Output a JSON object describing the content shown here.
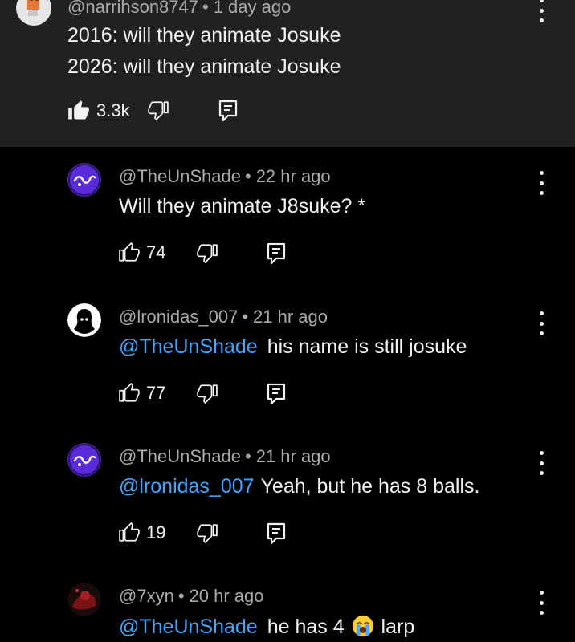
{
  "colors": {
    "background": "#000000",
    "highlight_bg": "#212121",
    "text": "#f1f1f1",
    "meta": "#aaaaaa",
    "mention": "#3ea6ff"
  },
  "comments": [
    {
      "author": "@narrihson8747",
      "time": "1 day ago",
      "lines": [
        "2016: will they animate Josuke",
        "2026: will they animate Josuke"
      ],
      "likes": "3.3k",
      "liked": true,
      "avatar": "orange-block-avatar"
    },
    {
      "author": "@TheUnShade",
      "time": "22 hr ago",
      "text": "Will they animate J8suke? *",
      "likes": "74",
      "avatar": "purple-swirl-avatar"
    },
    {
      "author": "@lronidas_007",
      "time": "21 hr ago",
      "mention": "@TheUnShade",
      "text": "his name is still josuke",
      "likes": "77",
      "avatar": "shadow-figure-avatar"
    },
    {
      "author": "@TheUnShade",
      "time": "21 hr ago",
      "mention": "@lronidas_007",
      "text": "Yeah, but he has 8 balls.",
      "likes": "19",
      "avatar": "purple-swirl-avatar"
    },
    {
      "author": "@7xyn",
      "time": "20 hr ago",
      "mention": "@TheUnShade",
      "text_before_emoji": "he has 4",
      "emoji": "loudly-crying-face",
      "text_after_emoji": "larp",
      "avatar": "red-figure-avatar"
    }
  ],
  "icons": {
    "like": "thumbs-up-icon",
    "dislike": "thumbs-down-icon",
    "reply": "reply-icon",
    "menu": "more-vert-icon"
  }
}
